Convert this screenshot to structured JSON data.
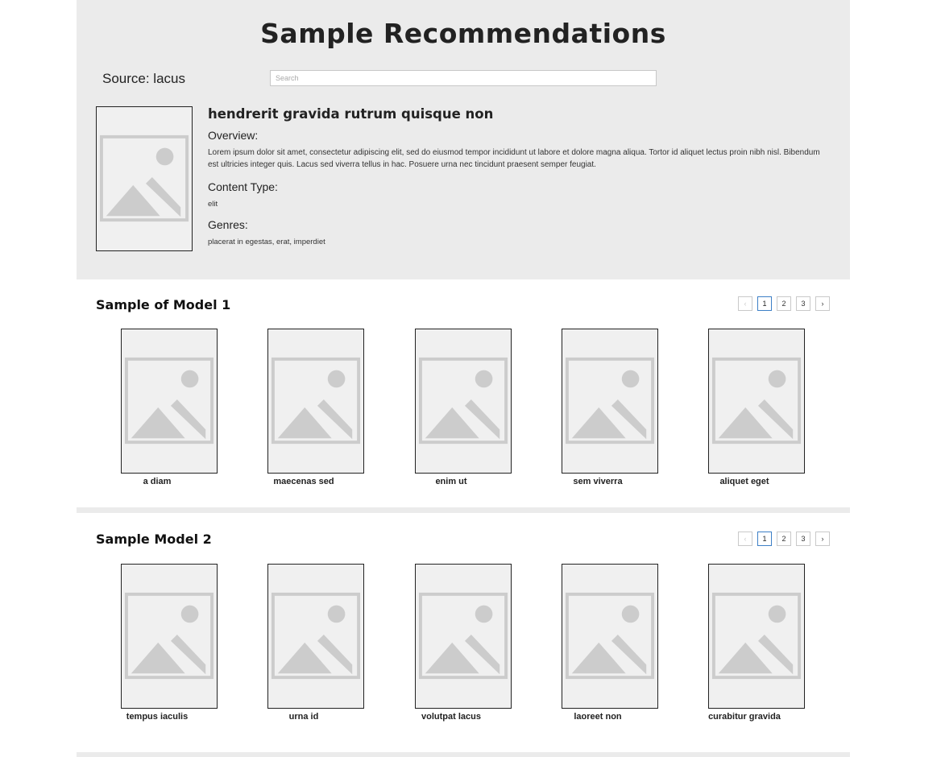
{
  "header": {
    "title": "Sample Recommendations",
    "source": "Source: lacus",
    "search_placeholder": "Search"
  },
  "selected": {
    "title": "hendrerit gravida rutrum quisque non",
    "overview_label": "Overview:",
    "overview": "Lorem ipsum dolor sit amet, consectetur adipiscing elit, sed do eiusmod tempor incididunt ut labore et dolore magna aliqua. Tortor id aliquet lectus proin nibh nisl. Bibendum est ultricies integer quis. Lacus sed viverra tellus in hac. Posuere urna nec tincidunt praesent semper feugiat.",
    "content_type_label": "Content Type:",
    "content_type": "elit",
    "genres_label": "Genres:",
    "genres": "placerat in egestas, erat, imperdiet"
  },
  "sections": [
    {
      "title": "Sample of Model 1",
      "pager": {
        "prev": "‹",
        "pages": [
          "1",
          "2",
          "3"
        ],
        "next": "›",
        "current": "1"
      },
      "items": [
        "a diam",
        "maecenas sed",
        "enim ut",
        "sem viverra",
        "aliquet eget"
      ]
    },
    {
      "title": "Sample Model 2",
      "pager": {
        "prev": "‹",
        "pages": [
          "1",
          "2",
          "3"
        ],
        "next": "›",
        "current": "1"
      },
      "items": [
        "tempus iaculis",
        "urna id",
        "volutpat lacus",
        "laoreet non",
        "curabitur gravida"
      ]
    }
  ],
  "icons": {
    "placeholder": "image-placeholder-icon"
  },
  "colors": {
    "panel": "#ebebeb",
    "active_page": "#3d7fc6",
    "placeholder": "#cccccc"
  }
}
